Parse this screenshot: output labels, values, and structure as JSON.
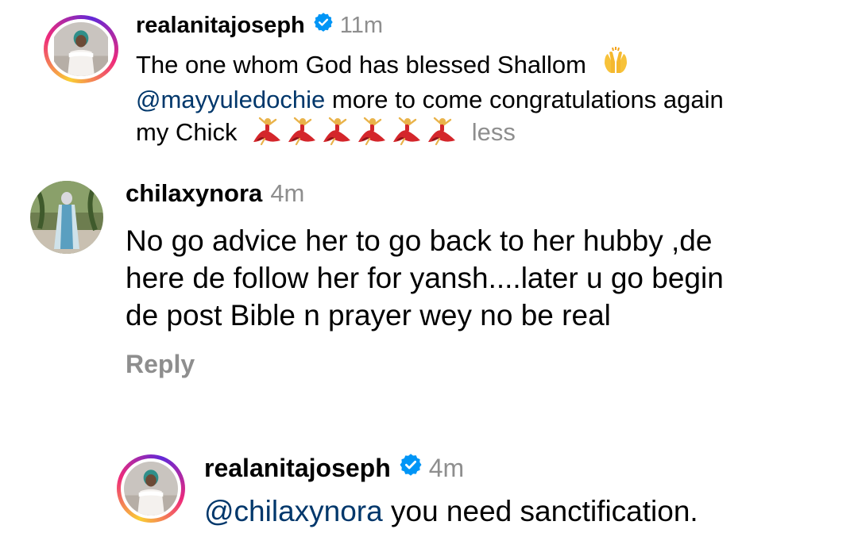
{
  "comments": [
    {
      "username": "realanitajoseph",
      "verified": true,
      "time": "11m",
      "line1": "The one whom God has blessed Shallom",
      "line1_emoji": "raising-hands",
      "mention": "@mayyuledochie",
      "line2_rest": " more to come congratulations again",
      "line3": "my Chick",
      "line3_emoji_count": 6,
      "line3_emoji": "woman-dancing",
      "less_label": "less"
    },
    {
      "username": "chilaxynora",
      "verified": false,
      "time": "4m",
      "body_lines": [
        "No go advice her to go back to her hubby ,de",
        "here de follow her for yansh....later u go begin",
        "de post Bible n prayer wey no be real"
      ],
      "reply_label": "Reply"
    },
    {
      "username": "realanitajoseph",
      "verified": true,
      "time": "4m",
      "mention": "@chilaxynora",
      "text_rest": " you need sanctification."
    }
  ],
  "colors": {
    "mention": "#00376b",
    "muted": "#8e8e8e",
    "verified": "#0095f6"
  }
}
